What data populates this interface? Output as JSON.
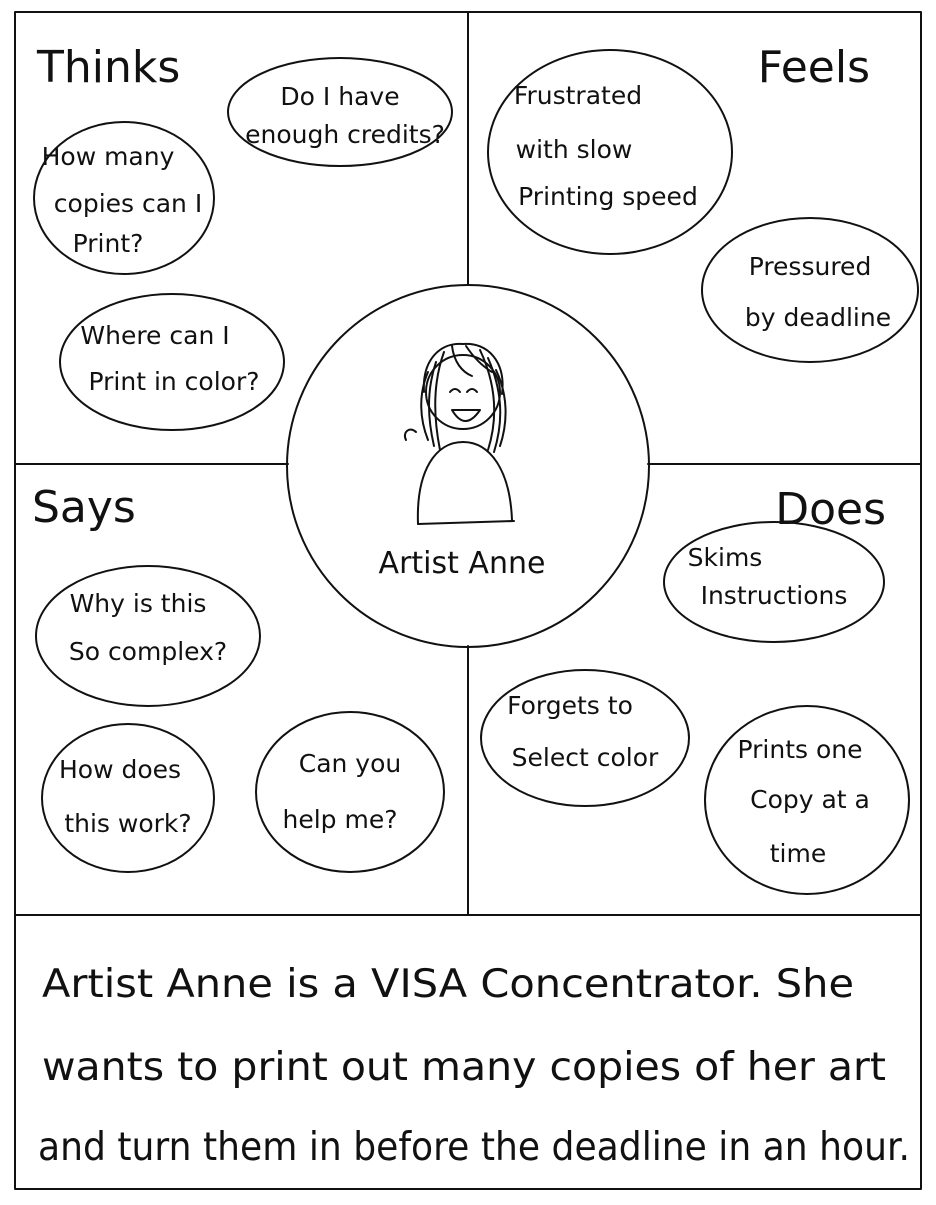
{
  "persona": {
    "name": "Artist Anne",
    "avatar_icon": "woman-avatar-icon"
  },
  "quadrants": {
    "thinks": {
      "heading": "Thinks",
      "bubbles": [
        {
          "lines": [
            "Do I have",
            "enough credits?"
          ]
        },
        {
          "lines": [
            "How many",
            "copies can I",
            "Print?"
          ]
        },
        {
          "lines": [
            "Where can I",
            "Print in color?"
          ]
        }
      ]
    },
    "feels": {
      "heading": "Feels",
      "bubbles": [
        {
          "lines": [
            "Frustrated",
            "with slow",
            "Printing speed"
          ]
        },
        {
          "lines": [
            "Pressured",
            "by deadline"
          ]
        }
      ]
    },
    "says": {
      "heading": "Says",
      "bubbles": [
        {
          "lines": [
            "Why is this",
            "So complex?"
          ]
        },
        {
          "lines": [
            "How does",
            "this work?"
          ]
        },
        {
          "lines": [
            "Can you",
            "help me?"
          ]
        }
      ]
    },
    "does": {
      "heading": "Does",
      "bubbles": [
        {
          "lines": [
            "Skims",
            "Instructions"
          ]
        },
        {
          "lines": [
            "Forgets to",
            "Select color"
          ]
        },
        {
          "lines": [
            "Prints one",
            "Copy at a",
            "time"
          ]
        }
      ]
    }
  },
  "summary": {
    "lines": [
      "Artist Anne is a VISA Concentrator. She",
      "wants to print out many copies of her art",
      "and turn them in before the deadline in an hour."
    ]
  },
  "colors": {
    "ink": "#111111",
    "paper": "#ffffff"
  }
}
